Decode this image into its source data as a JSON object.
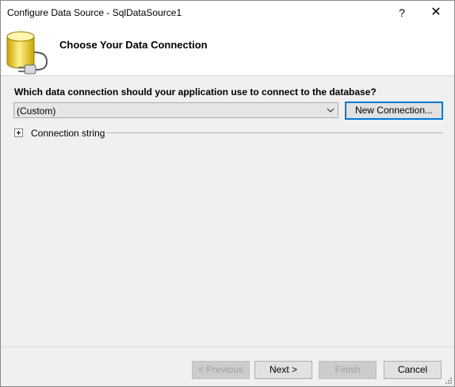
{
  "window": {
    "title": "Configure Data Source - SqlDataSource1",
    "help_label": "?",
    "close_label": "✕"
  },
  "header": {
    "title": "Choose Your Data Connection",
    "icon": "database-plug-icon"
  },
  "main": {
    "question": "Which data connection should your application use to connect to the database?",
    "connection_combo": {
      "value": "(Custom)"
    },
    "new_connection_label": "New Connection...",
    "connection_string_label": "Connection string"
  },
  "footer": {
    "previous_label": "< Previous",
    "next_label": "Next >",
    "finish_label": "Finish",
    "cancel_label": "Cancel"
  },
  "colors": {
    "accent": "#0078d7",
    "dialog_bg": "#f0f0f0",
    "header_bg": "#ffffff"
  }
}
